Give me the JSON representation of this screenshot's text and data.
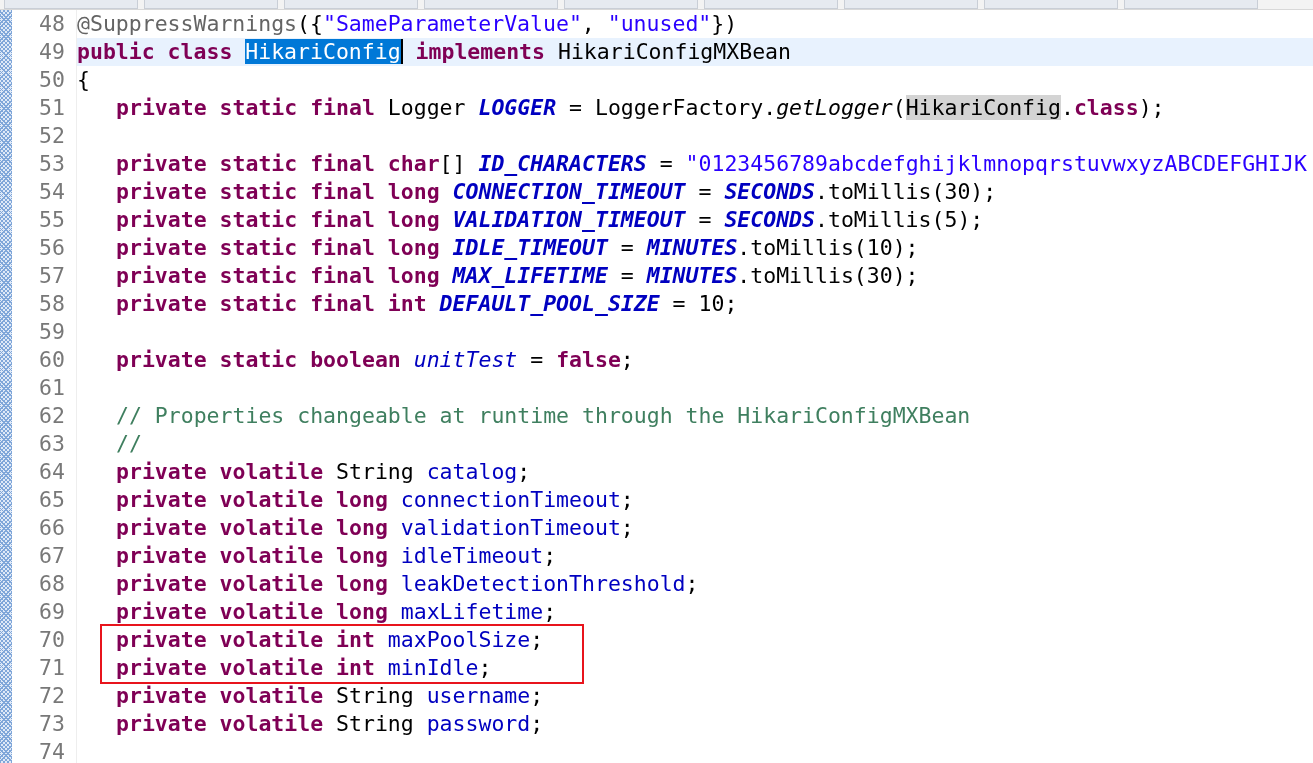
{
  "editor": {
    "lines": [
      {
        "number": "48",
        "current": false,
        "boxed": false,
        "indented": false,
        "tokens": [
          {
            "kind": "annotation",
            "text": "@SuppressWarnings"
          },
          {
            "kind": "plain",
            "text": "({"
          },
          {
            "kind": "string",
            "text": "\"SameParameterValue\""
          },
          {
            "kind": "plain",
            "text": ", "
          },
          {
            "kind": "string",
            "text": "\"unused\""
          },
          {
            "kind": "plain",
            "text": "})"
          }
        ]
      },
      {
        "number": "49",
        "current": true,
        "boxed": false,
        "indented": false,
        "tokens": [
          {
            "kind": "keyword",
            "text": "public class "
          },
          {
            "kind": "selection",
            "text": "HikariConfig"
          },
          {
            "kind": "keyword",
            "text": " implements "
          },
          {
            "kind": "plain",
            "text": "HikariConfigMXBean"
          }
        ]
      },
      {
        "number": "50",
        "current": false,
        "boxed": false,
        "indented": false,
        "tokens": [
          {
            "kind": "plain",
            "text": "{"
          }
        ]
      },
      {
        "number": "51",
        "current": false,
        "boxed": false,
        "indented": true,
        "tokens": [
          {
            "kind": "keyword",
            "text": "private static final "
          },
          {
            "kind": "plain",
            "text": "Logger "
          },
          {
            "kind": "constant",
            "text": "LOGGER"
          },
          {
            "kind": "plain",
            "text": " = LoggerFactory."
          },
          {
            "kind": "method",
            "text": "getLogger"
          },
          {
            "kind": "plain",
            "text": "("
          },
          {
            "kind": "occurrence",
            "text": "HikariConfig"
          },
          {
            "kind": "plain",
            "text": "."
          },
          {
            "kind": "keyword",
            "text": "class"
          },
          {
            "kind": "plain",
            "text": ");"
          }
        ]
      },
      {
        "number": "52"
      },
      {
        "number": "53",
        "current": false,
        "boxed": false,
        "indented": true,
        "tokens": [
          {
            "kind": "keyword",
            "text": "private static final char"
          },
          {
            "kind": "plain",
            "text": "[] "
          },
          {
            "kind": "constant",
            "text": "ID_CHARACTERS"
          },
          {
            "kind": "plain",
            "text": " = "
          },
          {
            "kind": "string",
            "text": "\"0123456789abcdefghijklmnopqrstuvwxyzABCDEFGHIJK"
          }
        ]
      },
      {
        "number": "54",
        "current": false,
        "boxed": false,
        "indented": true,
        "tokens": [
          {
            "kind": "keyword",
            "text": "private static final long "
          },
          {
            "kind": "constant",
            "text": "CONNECTION_TIMEOUT"
          },
          {
            "kind": "plain",
            "text": " = "
          },
          {
            "kind": "constant",
            "text": "SECONDS"
          },
          {
            "kind": "plain",
            "text": ".toMillis(30);"
          }
        ]
      },
      {
        "number": "55",
        "current": false,
        "boxed": false,
        "indented": true,
        "tokens": [
          {
            "kind": "keyword",
            "text": "private static final long "
          },
          {
            "kind": "constant",
            "text": "VALIDATION_TIMEOUT"
          },
          {
            "kind": "plain",
            "text": " = "
          },
          {
            "kind": "constant",
            "text": "SECONDS"
          },
          {
            "kind": "plain",
            "text": ".toMillis(5);"
          }
        ]
      },
      {
        "number": "56",
        "current": false,
        "boxed": false,
        "indented": true,
        "tokens": [
          {
            "kind": "keyword",
            "text": "private static final long "
          },
          {
            "kind": "constant",
            "text": "IDLE_TIMEOUT"
          },
          {
            "kind": "plain",
            "text": " = "
          },
          {
            "kind": "constant",
            "text": "MINUTES"
          },
          {
            "kind": "plain",
            "text": ".toMillis(10);"
          }
        ]
      },
      {
        "number": "57",
        "current": false,
        "boxed": false,
        "indented": true,
        "tokens": [
          {
            "kind": "keyword",
            "text": "private static final long "
          },
          {
            "kind": "constant",
            "text": "MAX_LIFETIME"
          },
          {
            "kind": "plain",
            "text": " = "
          },
          {
            "kind": "constant",
            "text": "MINUTES"
          },
          {
            "kind": "plain",
            "text": ".toMillis(30);"
          }
        ]
      },
      {
        "number": "58",
        "current": false,
        "boxed": false,
        "indented": true,
        "tokens": [
          {
            "kind": "keyword",
            "text": "private static final int "
          },
          {
            "kind": "constant",
            "text": "DEFAULT_POOL_SIZE"
          },
          {
            "kind": "plain",
            "text": " = 10;"
          }
        ]
      },
      {
        "number": "59"
      },
      {
        "number": "60",
        "current": false,
        "boxed": false,
        "indented": true,
        "tokens": [
          {
            "kind": "keyword",
            "text": "private static boolean "
          },
          {
            "kind": "static-field",
            "text": "unitTest"
          },
          {
            "kind": "plain",
            "text": " = "
          },
          {
            "kind": "keyword",
            "text": "false"
          },
          {
            "kind": "plain",
            "text": ";"
          }
        ]
      },
      {
        "number": "61"
      },
      {
        "number": "62",
        "current": false,
        "boxed": false,
        "indented": true,
        "tokens": [
          {
            "kind": "comment",
            "text": "// Properties changeable at runtime through the HikariConfigMXBean"
          }
        ]
      },
      {
        "number": "63",
        "current": false,
        "boxed": false,
        "indented": true,
        "tokens": [
          {
            "kind": "comment",
            "text": "//"
          }
        ]
      },
      {
        "number": "64",
        "current": false,
        "boxed": false,
        "indented": true,
        "tokens": [
          {
            "kind": "keyword",
            "text": "private volatile "
          },
          {
            "kind": "plain",
            "text": "String "
          },
          {
            "kind": "field",
            "text": "catalog"
          },
          {
            "kind": "plain",
            "text": ";"
          }
        ]
      },
      {
        "number": "65",
        "current": false,
        "boxed": false,
        "indented": true,
        "tokens": [
          {
            "kind": "keyword",
            "text": "private volatile long "
          },
          {
            "kind": "field",
            "text": "connectionTimeout"
          },
          {
            "kind": "plain",
            "text": ";"
          }
        ]
      },
      {
        "number": "66",
        "current": false,
        "boxed": false,
        "indented": true,
        "tokens": [
          {
            "kind": "keyword",
            "text": "private volatile long "
          },
          {
            "kind": "field",
            "text": "validationTimeout"
          },
          {
            "kind": "plain",
            "text": ";"
          }
        ]
      },
      {
        "number": "67",
        "current": false,
        "boxed": false,
        "indented": true,
        "tokens": [
          {
            "kind": "keyword",
            "text": "private volatile long "
          },
          {
            "kind": "field",
            "text": "idleTimeout"
          },
          {
            "kind": "plain",
            "text": ";"
          }
        ]
      },
      {
        "number": "68",
        "current": false,
        "boxed": false,
        "indented": true,
        "tokens": [
          {
            "kind": "keyword",
            "text": "private volatile long "
          },
          {
            "kind": "field",
            "text": "leakDetectionThreshold"
          },
          {
            "kind": "plain",
            "text": ";"
          }
        ]
      },
      {
        "number": "69",
        "current": false,
        "boxed": false,
        "indented": true,
        "tokens": [
          {
            "kind": "keyword",
            "text": "private volatile long "
          },
          {
            "kind": "field",
            "text": "maxLifetime"
          },
          {
            "kind": "plain",
            "text": ";"
          }
        ]
      },
      {
        "number": "70",
        "current": false,
        "boxed": true,
        "indented": true,
        "tokens": [
          {
            "kind": "keyword",
            "text": "private volatile int "
          },
          {
            "kind": "field",
            "text": "maxPoolSize"
          },
          {
            "kind": "plain",
            "text": ";"
          }
        ]
      },
      {
        "number": "71",
        "current": false,
        "boxed": true,
        "indented": true,
        "tokens": [
          {
            "kind": "keyword",
            "text": "private volatile int "
          },
          {
            "kind": "field",
            "text": "minIdle"
          },
          {
            "kind": "plain",
            "text": ";"
          }
        ]
      },
      {
        "number": "72",
        "current": false,
        "boxed": false,
        "indented": true,
        "tokens": [
          {
            "kind": "keyword",
            "text": "private volatile "
          },
          {
            "kind": "plain",
            "text": "String "
          },
          {
            "kind": "field",
            "text": "username"
          },
          {
            "kind": "plain",
            "text": ";"
          }
        ]
      },
      {
        "number": "73",
        "current": false,
        "boxed": false,
        "indented": true,
        "tokens": [
          {
            "kind": "keyword",
            "text": "private volatile "
          },
          {
            "kind": "plain",
            "text": "String "
          },
          {
            "kind": "field",
            "text": "password"
          },
          {
            "kind": "plain",
            "text": ";"
          }
        ]
      },
      {
        "number": "74"
      }
    ]
  }
}
